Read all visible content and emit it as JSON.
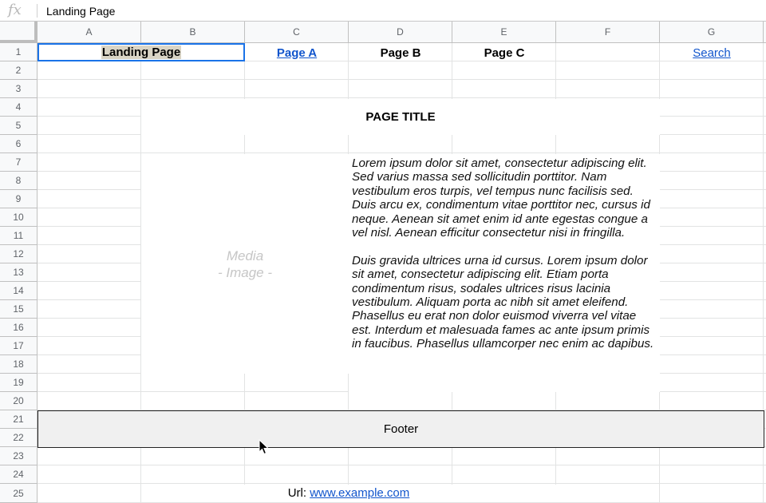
{
  "formula_bar": {
    "fx_label": "fx",
    "value": "Landing Page"
  },
  "columns": [
    "A",
    "B",
    "C",
    "D",
    "E",
    "F",
    "G"
  ],
  "rows": [
    "1",
    "2",
    "3",
    "4",
    "5",
    "6",
    "7",
    "8",
    "9",
    "10",
    "11",
    "12",
    "13",
    "14",
    "15",
    "16",
    "17",
    "18",
    "19",
    "20",
    "21",
    "22",
    "23",
    "24",
    "25"
  ],
  "nav": {
    "landing": "Landing Page",
    "page_a": "Page A",
    "page_b": "Page B",
    "page_c": "Page C",
    "search": "Search"
  },
  "page_title": "PAGE TITLE",
  "media": {
    "line1": "Media",
    "line2": "- Image -"
  },
  "body_text": {
    "p1": "Lorem ipsum dolor sit amet, consectetur adipiscing elit. Sed varius massa sed sollicitudin porttitor. Nam vestibulum eros turpis, vel tempus nunc facilisis sed. Duis arcu ex, condimentum vitae porttitor nec, cursus id neque. Aenean sit amet enim id ante egestas congue a vel nisl. Aenean efficitur consectetur nisi in fringilla.",
    "p2": "Duis gravida ultrices urna id cursus. Lorem ipsum dolor sit amet, consectetur adipiscing elit. Etiam porta condimentum risus, sodales ultrices risus lacinia vestibulum. Aliquam porta ac nibh sit amet eleifend. Phasellus eu erat non dolor euismod viverra vel vitae est. Interdum et malesuada fames ac ante ipsum primis in faucibus. Phasellus ullamcorper nec enim ac dapibus."
  },
  "footer": "Footer",
  "url_line": {
    "label": "Url:",
    "link": "www.example.com"
  },
  "colors": {
    "link": "#1155cc",
    "selection": "#1a73e8",
    "header_bg": "#f8f9fa",
    "footer_bg": "#f0f0f0"
  }
}
